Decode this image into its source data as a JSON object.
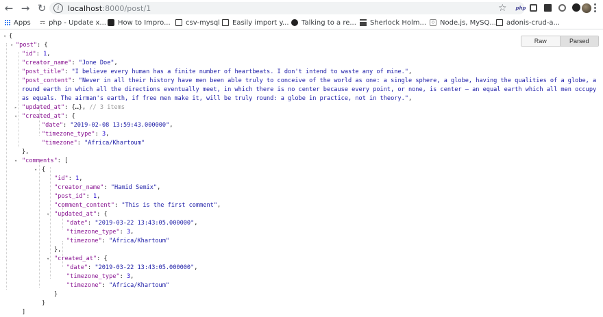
{
  "browser": {
    "url_host": "localhost",
    "url_rest": ":8000/post/1",
    "extension_label": "php"
  },
  "bookmarks": [
    {
      "label": "Apps",
      "icon": "apps-grid-icon"
    },
    {
      "label": "php - Update x...",
      "icon": "php-favicon-icon"
    },
    {
      "label": "How to Impro...",
      "icon": "page-favicon-icon"
    },
    {
      "label": "csv-mysql",
      "icon": "doc-favicon-icon"
    },
    {
      "label": "Easily import y...",
      "icon": "doc-favicon-icon"
    },
    {
      "label": "Talking to a re...",
      "icon": "github-icon"
    },
    {
      "label": "Sherlock Holm...",
      "icon": "hat-favicon-icon"
    },
    {
      "label": "Node.js, MySQ...",
      "icon": "node-favicon-icon"
    },
    {
      "label": "adonis-crud-a...",
      "icon": "doc-favicon-icon"
    }
  ],
  "viewer": {
    "raw_label": "Raw",
    "parsed_label": "Parsed"
  },
  "json_lines": {
    "open_root": "{",
    "post_key": "\"post\"",
    "id_key": "\"id\"",
    "id_val": "1",
    "creator_key": "\"creator_name\"",
    "creator_val": "\"Jone Doe\"",
    "title_key": "\"post_title\"",
    "title_val": "\"I believe every human has a finite number of heartbeats. I don't intend to waste any of mine.\"",
    "content_key": "\"post_content\"",
    "content_val": "\"Never in all their history have men been able truly to conceive of the world as one: a single sphere, a globe, having the qualities of a globe, a round earth in which all the directions eventually meet, in which there is no center because every point, or none, is center — an equal earth which all men occupy as equals. The airman's earth, if free men make it, will be truly round: a globe in practice, not in theory.\"",
    "updated_key": "\"updated_at\"",
    "updated_collapsed": "{…}",
    "updated_comment": "// 3 items",
    "created_key": "\"created_at\"",
    "date_key": "\"date\"",
    "post_created_date": "\"2019-02-08 13:59:43.000000\"",
    "tztype_key": "\"timezone_type\"",
    "tztype_val": "3",
    "tz_key": "\"timezone\"",
    "tz_val": "\"Africa/Khartoum\"",
    "comments_key": "\"comments\"",
    "c_id_val": "1",
    "c_creator_val": "\"Hamid Semix\"",
    "postid_key": "\"post_id\"",
    "postid_val": "1",
    "comment_content_key": "\"comment_content\"",
    "comment_content_val": "\"This is the first comment\"",
    "c_updated_date": "\"2019-03-22 13:43:05.000000\"",
    "c_created_date": "\"2019-03-22 13:43:05.000000\""
  }
}
